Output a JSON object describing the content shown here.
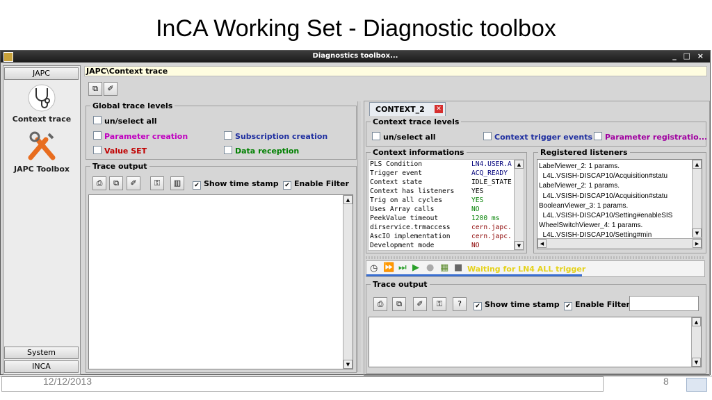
{
  "slide": {
    "title": "InCA Working Set - Diagnostic toolbox",
    "date": "12/12/2013",
    "page": "8"
  },
  "window": {
    "title": "Diagnostics toolbox...",
    "controls": "_ □ ×"
  },
  "nav": {
    "top_button": "JAPC",
    "items": [
      {
        "label": "Context trace",
        "icon": "stethoscope-icon"
      },
      {
        "label": "JAPC Toolbox",
        "icon": "tools-icon"
      }
    ],
    "bottom_buttons": [
      "System",
      "INCA"
    ]
  },
  "breadcrumb": "JAPC\\Context trace",
  "global_trace": {
    "legend": "Global trace levels",
    "select_all": "un/select all",
    "parameter_creation": "Parameter creation",
    "subscription_creation": "Subscription creation",
    "value_set": "Value SET",
    "data_reception": "Data reception"
  },
  "trace_output_left": {
    "legend": "Trace output",
    "show_time_stamp": "Show time stamp",
    "enable_filter": "Enable Filter"
  },
  "context_tab": "CONTEXT_2",
  "context_trace_levels": {
    "legend": "Context trace levels",
    "select_all": "un/select all",
    "context_trigger_events": "Context trigger events",
    "parameter_registration": "Parameter registratio..."
  },
  "context_info": {
    "legend": "Context informations",
    "rows": [
      {
        "key": "PLS Condition",
        "value": "LN4.USER.A"
      },
      {
        "key": "Trigger event",
        "value": "ACQ_READY"
      },
      {
        "key": "Context state",
        "value": "IDLE_STATE"
      },
      {
        "key": "Context has listeners",
        "value": "YES"
      },
      {
        "key": "Trig on all cycles",
        "value": "YES"
      },
      {
        "key": "Uses Array calls",
        "value": "NO"
      },
      {
        "key": "PeekValue timeout",
        "value": "1200 ms"
      },
      {
        "key": "dirservice.trmaccess",
        "value": "cern.japc."
      },
      {
        "key": "AscIO implementation",
        "value": "cern.japc."
      },
      {
        "key": "Development mode",
        "value": "NO"
      }
    ],
    "value_colors": [
      "#00007a",
      "#00007a",
      "#000000",
      "#000000",
      "#008000",
      "#008000",
      "#008000",
      "#8b0000",
      "#8b0000",
      "#8b0000"
    ]
  },
  "registered_listeners": {
    "legend": "Registered listeners",
    "lines": [
      "LabelViewer_2: 1 params.",
      "  L4L.VSISH-DISCAP10/Acquisition#statu",
      "LabelViewer_2: 1 params.",
      "  L4L.VSISH-DISCAP10/Acquisition#statu",
      "BooleanViewer_3: 1 params.",
      "  L4L.VSISH-DISCAP10/Setting#enableSIS",
      "WheelSwitchViewer_4: 1 params.",
      "  L4L.VSISH-DISCAP10/Setting#min"
    ]
  },
  "status": {
    "waiting": "Waiting for LN4 ALL trigger"
  },
  "trace_output_right": {
    "legend": "Trace output",
    "show_time_stamp": "Show time stamp",
    "enable_filter": "Enable Filter",
    "filter_value": ""
  }
}
